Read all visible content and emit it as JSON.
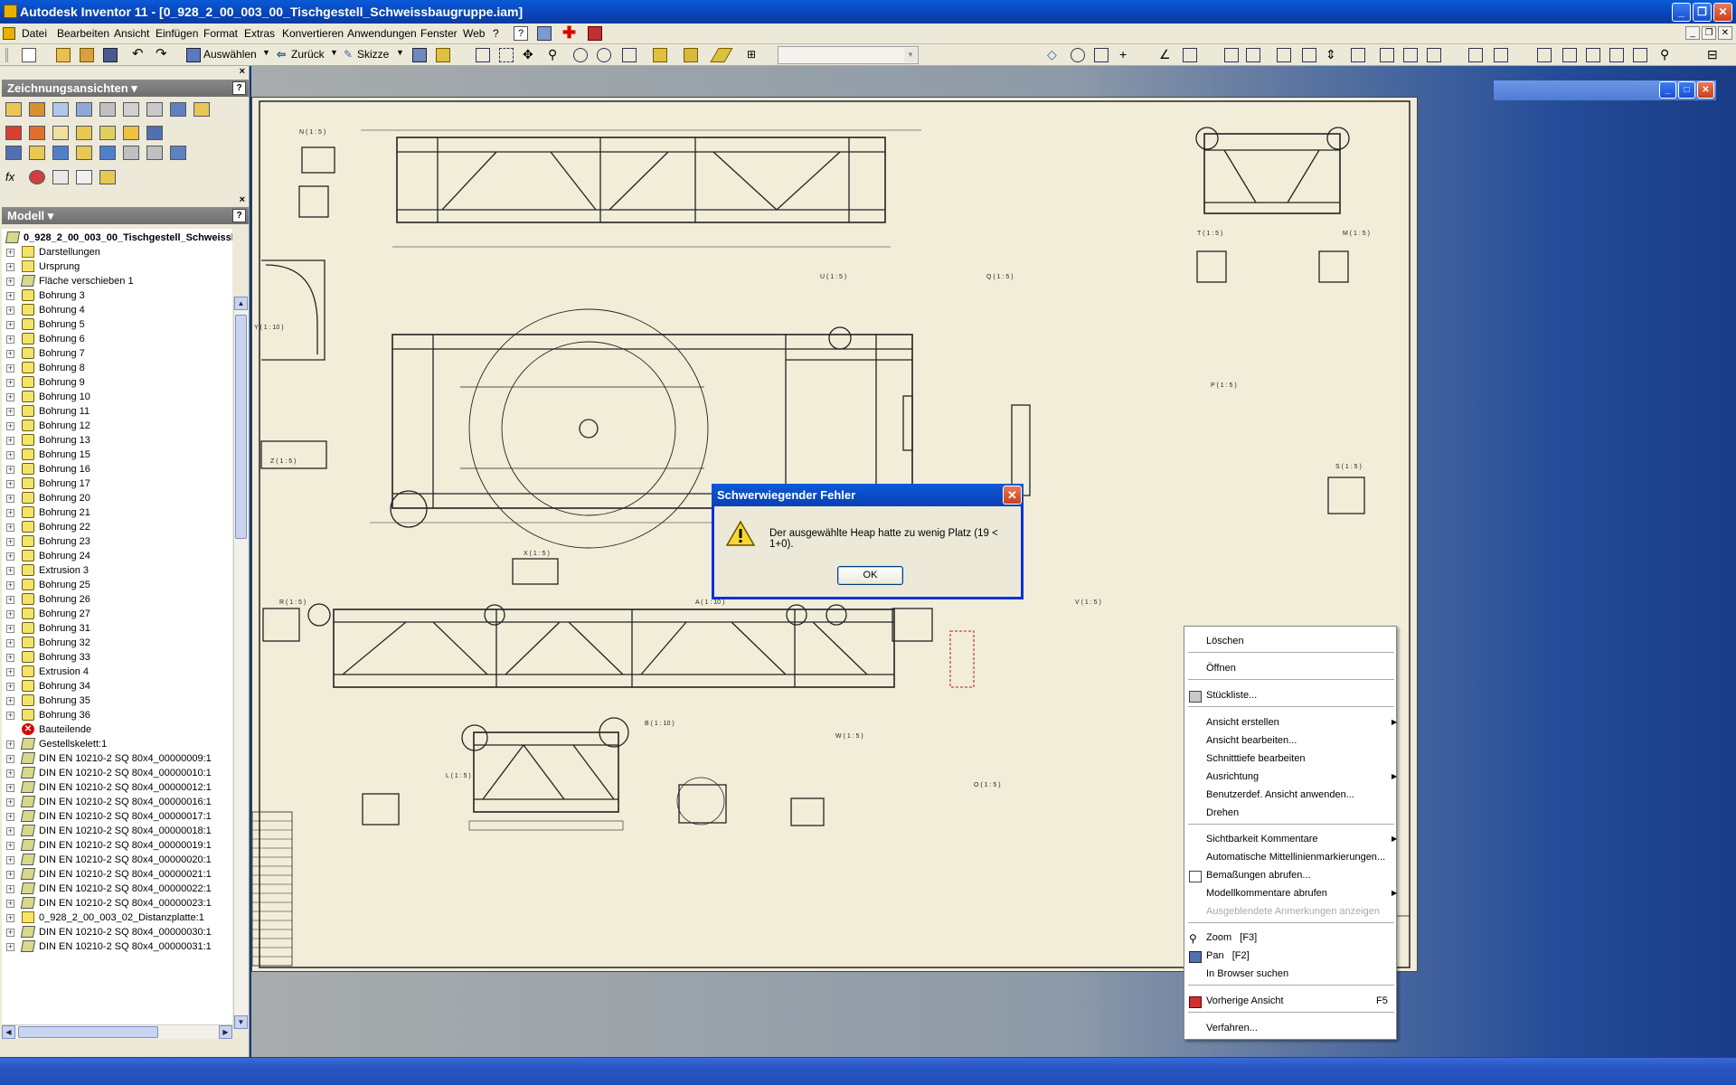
{
  "window": {
    "title": "Autodesk Inventor 11 - [0_928_2_00_003_00_Tischgestell_Schweissbaugruppe.iam]"
  },
  "menu": {
    "items": [
      "Datei",
      "Bearbeiten",
      "Ansicht",
      "Einfügen",
      "Format",
      "Extras",
      "Konvertieren",
      "Anwendungen",
      "Fenster",
      "Web"
    ],
    "help_label": "?"
  },
  "toolbar": {
    "select_label": "Auswählen",
    "back_label": "Zurück",
    "sketch_label": "Skizze"
  },
  "panels": {
    "drawing_views_title": "Zeichnungsansichten",
    "model_title": "Modell",
    "close_glyph": "×",
    "help_glyph": "?"
  },
  "tree": {
    "root": "0_928_2_00_003_00_Tischgestell_Schweissbaugruppe",
    "items": [
      {
        "label": "Darstellungen",
        "icon": "folder"
      },
      {
        "label": "Ursprung",
        "icon": "folder"
      },
      {
        "label": "Fläche verschieben 1",
        "icon": "part"
      },
      {
        "label": "Bohrung 3",
        "icon": "hole"
      },
      {
        "label": "Bohrung 4",
        "icon": "hole"
      },
      {
        "label": "Bohrung 5",
        "icon": "hole"
      },
      {
        "label": "Bohrung 6",
        "icon": "hole"
      },
      {
        "label": "Bohrung 7",
        "icon": "hole"
      },
      {
        "label": "Bohrung 8",
        "icon": "hole"
      },
      {
        "label": "Bohrung 9",
        "icon": "hole"
      },
      {
        "label": "Bohrung 10",
        "icon": "hole"
      },
      {
        "label": "Bohrung 11",
        "icon": "hole"
      },
      {
        "label": "Bohrung 12",
        "icon": "hole"
      },
      {
        "label": "Bohrung 13",
        "icon": "hole"
      },
      {
        "label": "Bohrung 15",
        "icon": "hole"
      },
      {
        "label": "Bohrung 16",
        "icon": "hole"
      },
      {
        "label": "Bohrung 17",
        "icon": "hole"
      },
      {
        "label": "Bohrung 20",
        "icon": "hole"
      },
      {
        "label": "Bohrung 21",
        "icon": "hole"
      },
      {
        "label": "Bohrung 22",
        "icon": "hole"
      },
      {
        "label": "Bohrung 23",
        "icon": "hole"
      },
      {
        "label": "Bohrung 24",
        "icon": "hole"
      },
      {
        "label": "Extrusion 3",
        "icon": "hole"
      },
      {
        "label": "Bohrung 25",
        "icon": "hole"
      },
      {
        "label": "Bohrung 26",
        "icon": "hole"
      },
      {
        "label": "Bohrung 27",
        "icon": "hole"
      },
      {
        "label": "Bohrung 31",
        "icon": "hole"
      },
      {
        "label": "Bohrung 32",
        "icon": "hole"
      },
      {
        "label": "Bohrung 33",
        "icon": "hole"
      },
      {
        "label": "Extrusion 4",
        "icon": "hole"
      },
      {
        "label": "Bohrung 34",
        "icon": "hole"
      },
      {
        "label": "Bohrung 35",
        "icon": "hole"
      },
      {
        "label": "Bohrung 36",
        "icon": "hole"
      },
      {
        "label": "Bauteilende",
        "icon": "error"
      },
      {
        "label": "Gestellskelett:1",
        "icon": "part"
      },
      {
        "label": "DIN EN 10210-2 SQ 80x4_00000009:1",
        "icon": "part"
      },
      {
        "label": "DIN EN 10210-2 SQ 80x4_00000010:1",
        "icon": "part"
      },
      {
        "label": "DIN EN 10210-2 SQ 80x4_00000012:1",
        "icon": "part"
      },
      {
        "label": "DIN EN 10210-2 SQ 80x4_00000016:1",
        "icon": "part"
      },
      {
        "label": "DIN EN 10210-2 SQ 80x4_00000017:1",
        "icon": "part"
      },
      {
        "label": "DIN EN 10210-2 SQ 80x4_00000018:1",
        "icon": "part"
      },
      {
        "label": "DIN EN 10210-2 SQ 80x4_00000019:1",
        "icon": "part"
      },
      {
        "label": "DIN EN 10210-2 SQ 80x4_00000020:1",
        "icon": "part"
      },
      {
        "label": "DIN EN 10210-2 SQ 80x4_00000021:1",
        "icon": "part"
      },
      {
        "label": "DIN EN 10210-2 SQ 80x4_00000022:1",
        "icon": "part"
      },
      {
        "label": "DIN EN 10210-2 SQ 80x4_00000023:1",
        "icon": "part"
      },
      {
        "label": "0_928_2_00_003_02_Distanzplatte:1",
        "icon": "folder"
      },
      {
        "label": "DIN EN 10210-2 SQ 80x4_00000030:1",
        "icon": "part"
      },
      {
        "label": "DIN EN 10210-2 SQ 80x4_00000031:1",
        "icon": "part"
      }
    ]
  },
  "drawing": {
    "view_labels": [
      "N ( 1 : 5 )",
      "T ( 1 : 5 )",
      "M ( 1 : 5 )",
      "U ( 1 : 5 )",
      "Q ( 1 : 5 )",
      "Y ( 1 : 10 )",
      "P ( 1 : 5 )",
      "Z ( 1 : 5 )",
      "S ( 1 : 5 )",
      "X ( 1 : 5 )",
      "R ( 1 : 5 )",
      "A ( 1 : 10 )",
      "V ( 1 : 5 )",
      "W ( 1 : 5 )",
      "B ( 1 : 10 )",
      "L ( 1 : 5 )",
      "O ( 1 : 5 )"
    ]
  },
  "dialog": {
    "title": "Schwerwiegender Fehler",
    "message": "Der ausgewählte Heap hatte zu wenig Platz (19 < 1+0).",
    "ok_label": "OK"
  },
  "context_menu": {
    "items": [
      {
        "label": "Löschen"
      },
      {
        "label": "Öffnen"
      },
      {
        "label": "Stückliste..."
      },
      {
        "label": "Ansicht erstellen"
      },
      {
        "label": "Ansicht bearbeiten..."
      },
      {
        "label": "Schnitttiefe bearbeiten"
      },
      {
        "label": "Ausrichtung"
      },
      {
        "label": "Benutzerdef. Ansicht anwenden..."
      },
      {
        "label": "Drehen"
      },
      {
        "label": "Sichtbarkeit Kommentare"
      },
      {
        "label": "Automatische Mittellinienmarkierungen..."
      },
      {
        "label": "Bemaßungen abrufen..."
      },
      {
        "label": "Modellkommentare abrufen"
      },
      {
        "label": "Ausgeblendete Anmerkungen anzeigen"
      },
      {
        "label": "Zoom   [F3]"
      },
      {
        "label": "Pan   [F2]"
      },
      {
        "label": "In Browser suchen"
      },
      {
        "label": "Vorherige Ansicht",
        "shortcut": "F5"
      },
      {
        "label": "Verfahren..."
      }
    ]
  }
}
